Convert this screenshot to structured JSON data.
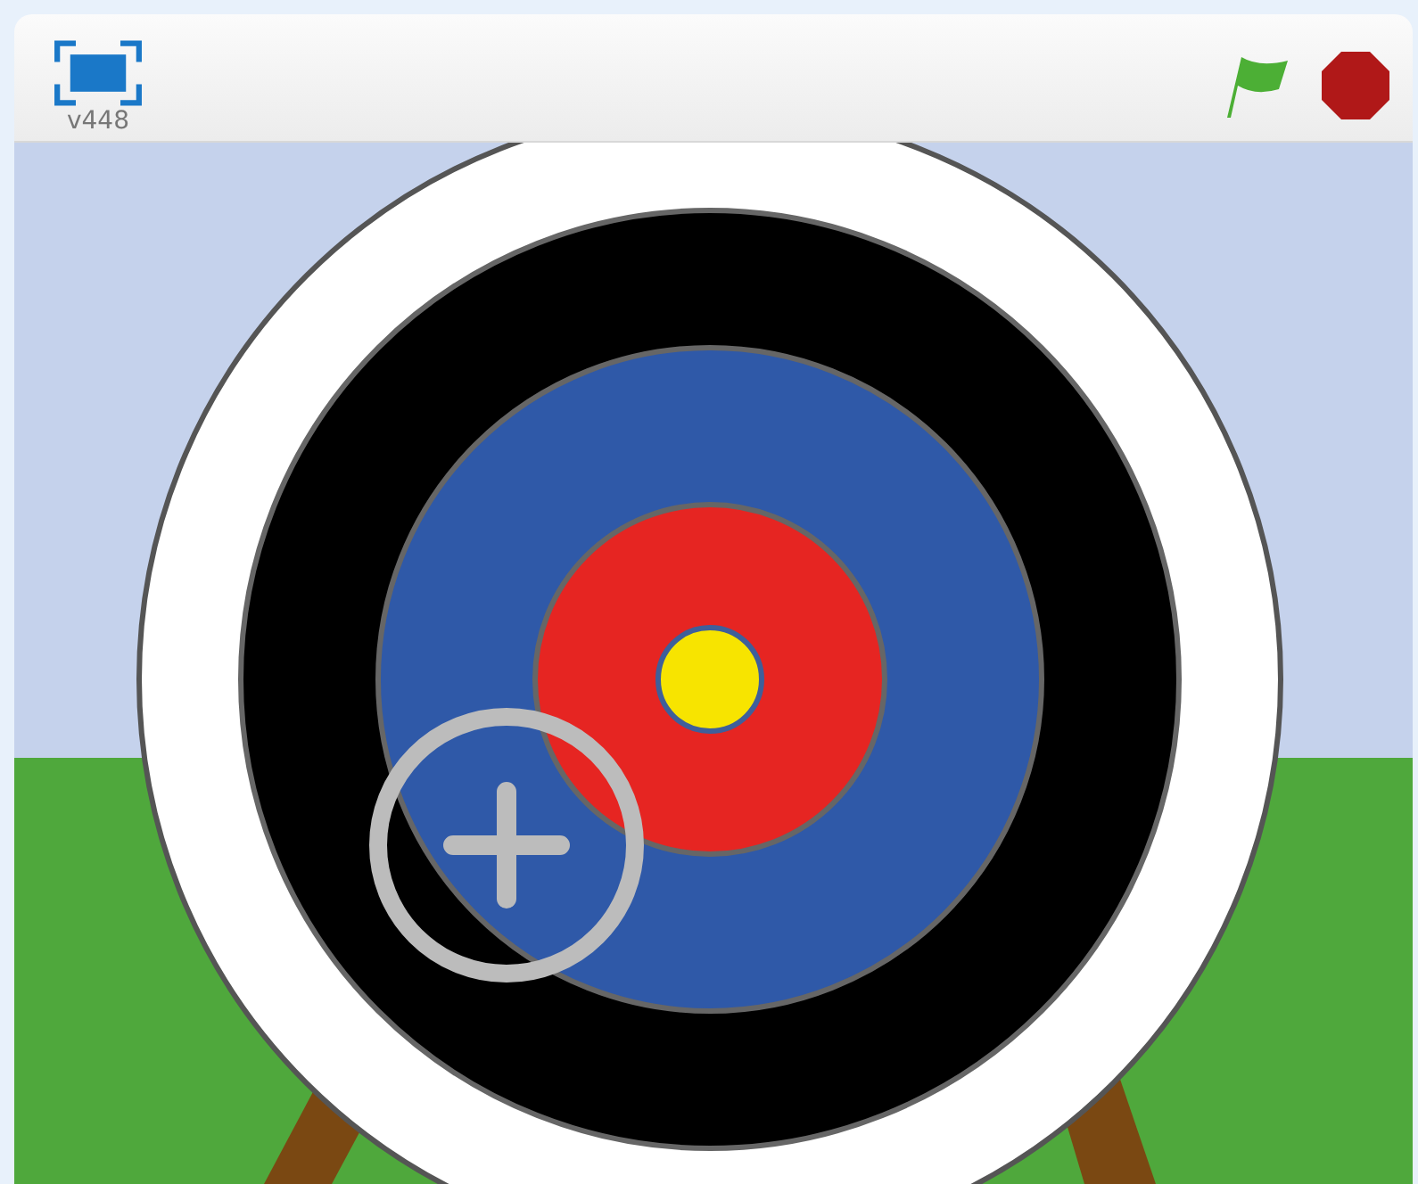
{
  "toolbar": {
    "version_label": "v448"
  }
}
